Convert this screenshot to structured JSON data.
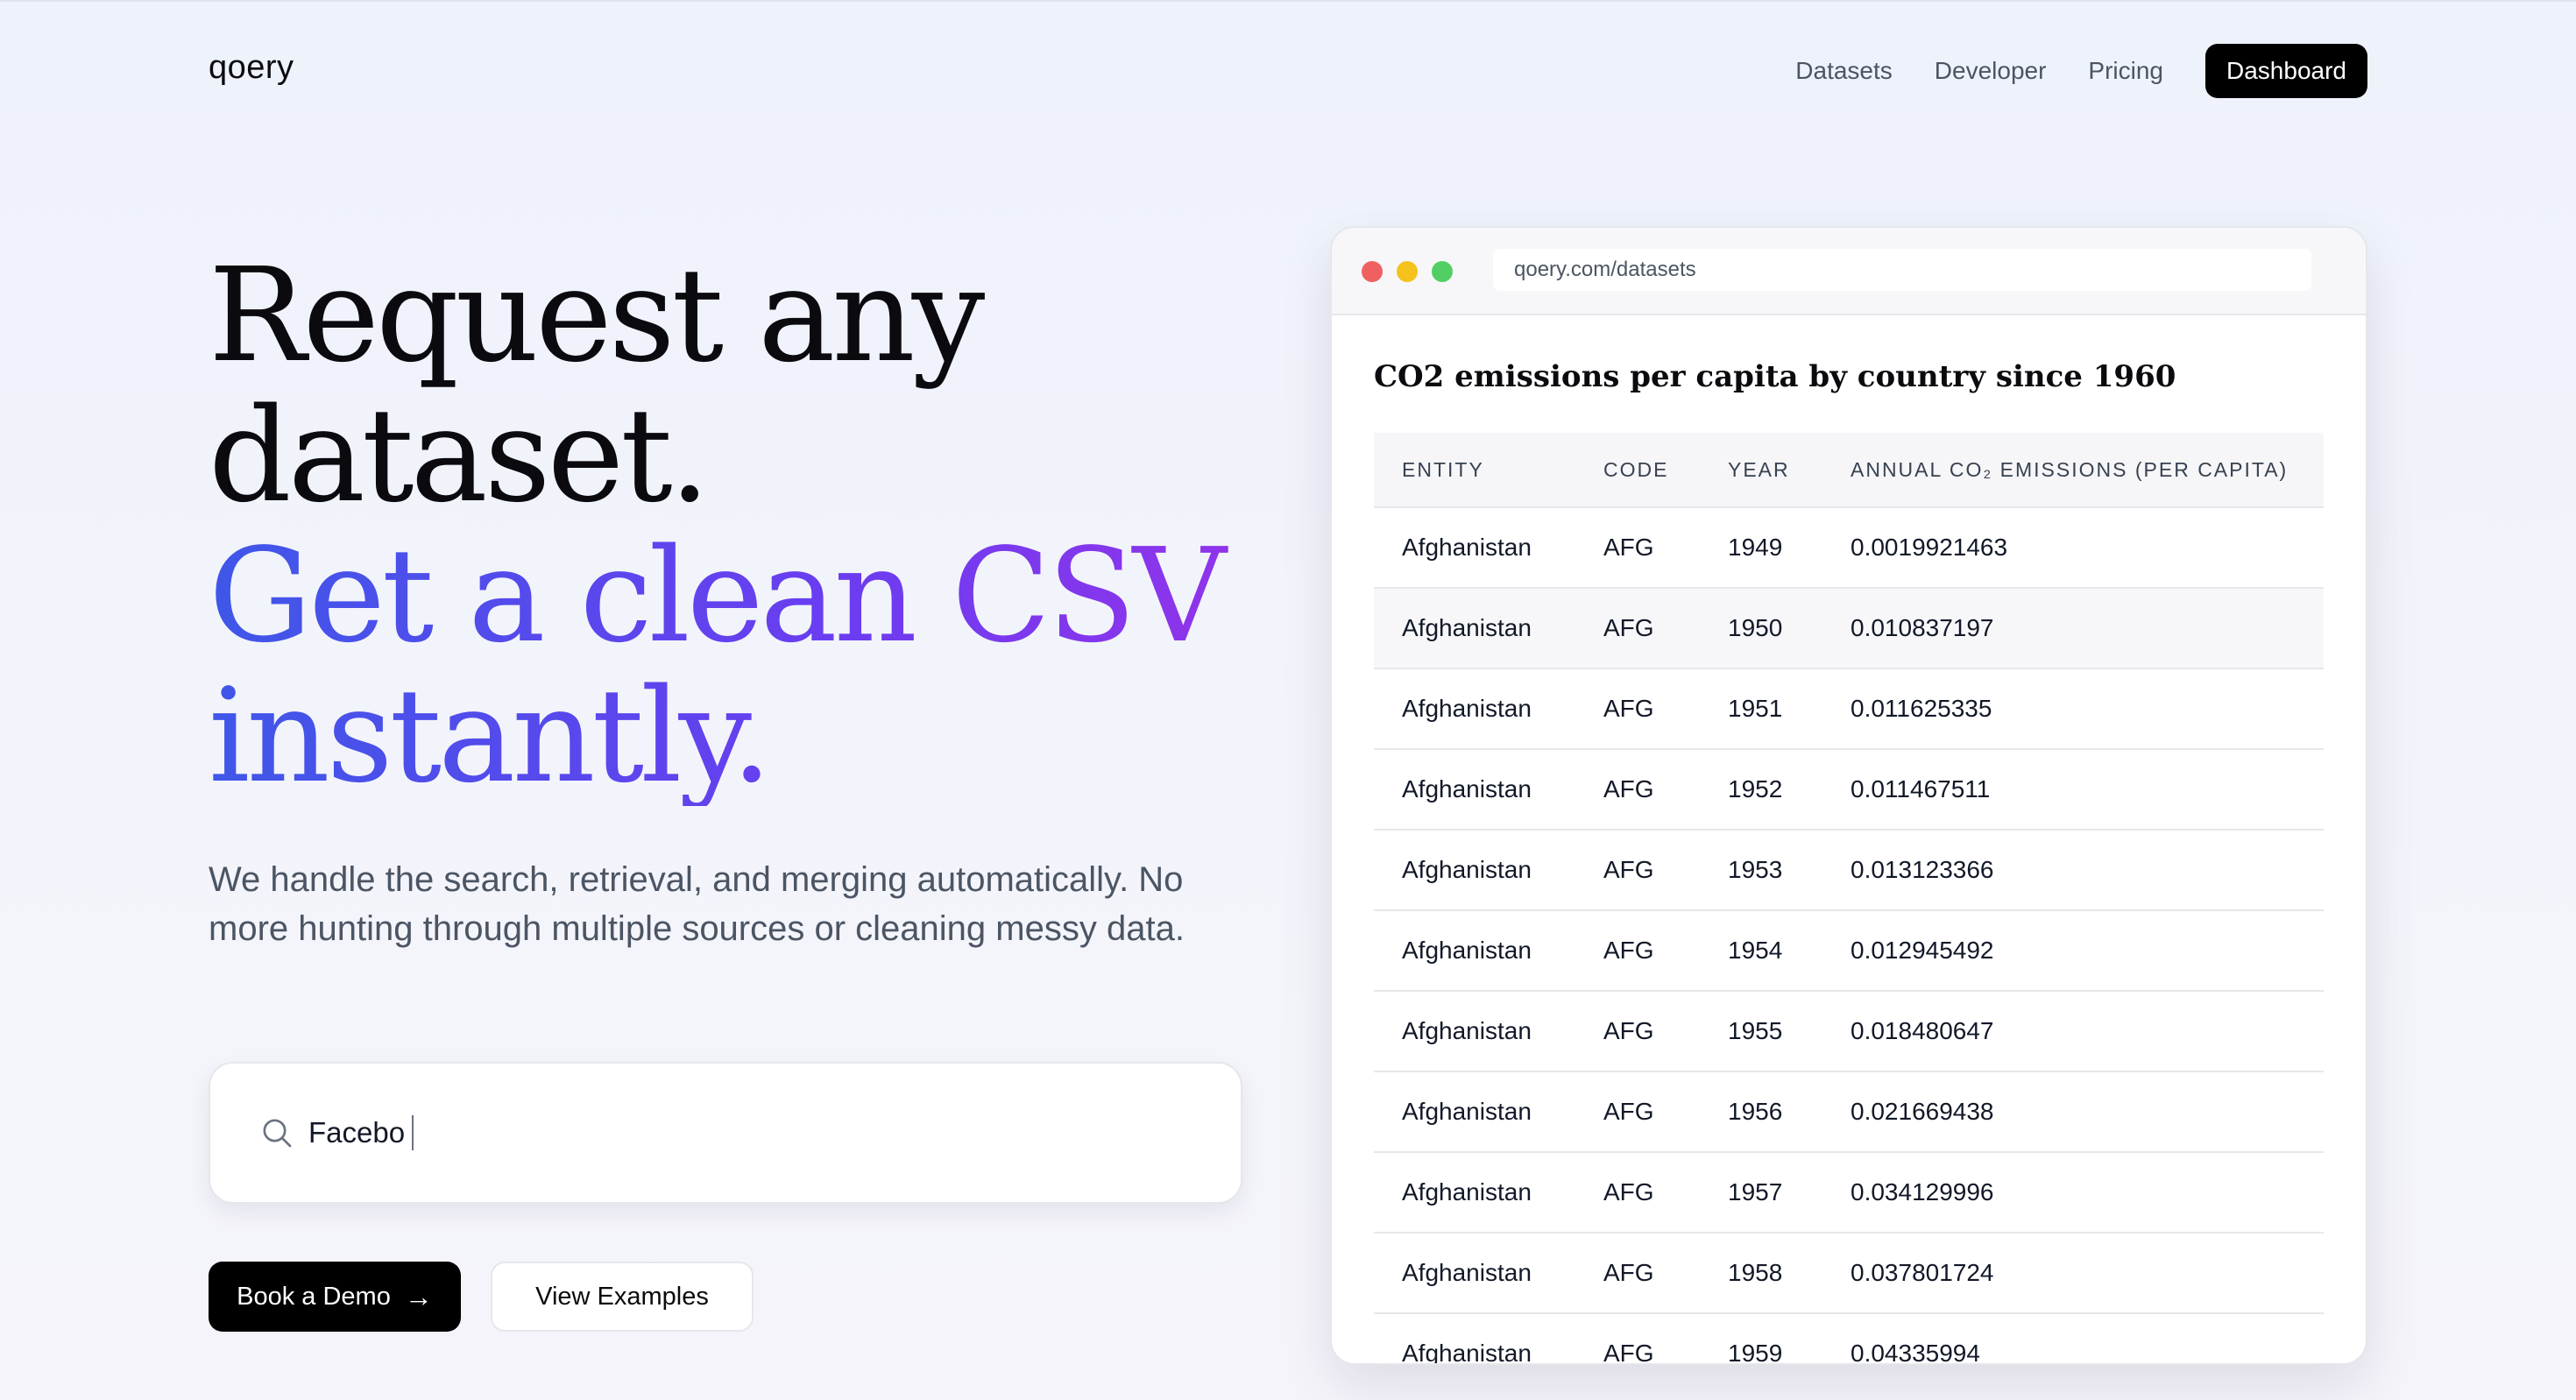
{
  "header": {
    "logo": "qoery",
    "nav": [
      "Datasets",
      "Developer",
      "Pricing"
    ],
    "cta": "Dashboard"
  },
  "hero": {
    "line1": "Request any",
    "line2": "dataset.",
    "line3": "Get a clean CSV",
    "line4": "instantly.",
    "subtitle": "We handle the search, retrieval, and merging automatically. No more hunting through multiple sources or cleaning messy data."
  },
  "search": {
    "value": "Facebo"
  },
  "buttons": {
    "demo": "Book a Demo",
    "demo_arrow": "→",
    "examples": "View Examples"
  },
  "browser": {
    "url": "qoery.com/datasets",
    "dataset_title": "CO2 emissions per capita by country since 1960",
    "columns": [
      "ENTITY",
      "CODE",
      "YEAR",
      "ANNUAL CO₂ EMISSIONS (PER CAPITA)"
    ],
    "rows": [
      [
        "Afghanistan",
        "AFG",
        "1949",
        "0.0019921463"
      ],
      [
        "Afghanistan",
        "AFG",
        "1950",
        "0.010837197"
      ],
      [
        "Afghanistan",
        "AFG",
        "1951",
        "0.011625335"
      ],
      [
        "Afghanistan",
        "AFG",
        "1952",
        "0.011467511"
      ],
      [
        "Afghanistan",
        "AFG",
        "1953",
        "0.013123366"
      ],
      [
        "Afghanistan",
        "AFG",
        "1954",
        "0.012945492"
      ],
      [
        "Afghanistan",
        "AFG",
        "1955",
        "0.018480647"
      ],
      [
        "Afghanistan",
        "AFG",
        "1956",
        "0.021669438"
      ],
      [
        "Afghanistan",
        "AFG",
        "1957",
        "0.034129996"
      ],
      [
        "Afghanistan",
        "AFG",
        "1958",
        "0.037801724"
      ],
      [
        "Afghanistan",
        "AFG",
        "1959",
        "0.04335994"
      ]
    ]
  },
  "colors": {
    "accent_start": "#3f57e8",
    "accent_end": "#9333ea",
    "primary_button": "#000000"
  },
  "icons": {
    "search": "search-icon",
    "arrow": "arrow-right-icon"
  }
}
